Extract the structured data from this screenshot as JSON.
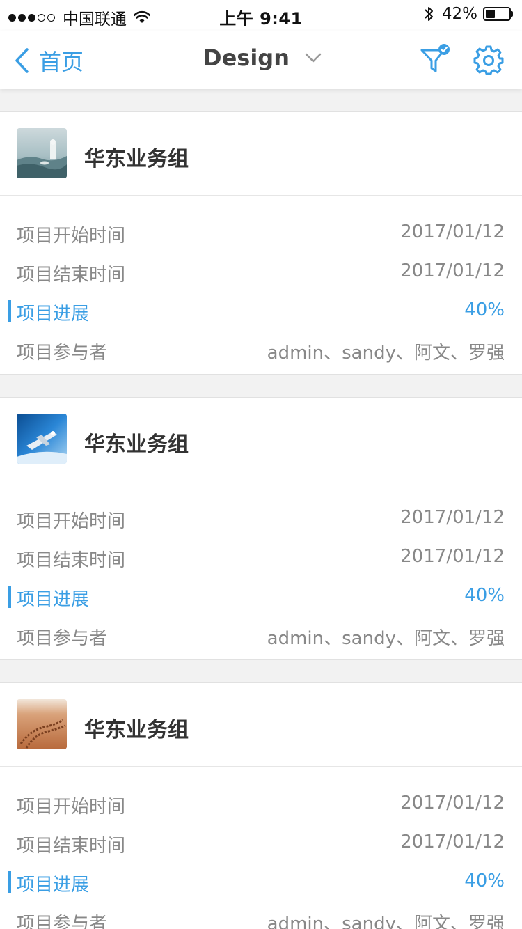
{
  "status_bar": {
    "carrier": "中国联通",
    "time": "上午 9:41",
    "battery_percent": "42%",
    "battery_level": 0.42,
    "signal_bars": 3
  },
  "nav": {
    "back_label": "首页",
    "title": "Design",
    "accent_color": "#3a9ee4"
  },
  "projects": [
    {
      "group_name": "华东业务组",
      "thumbnail": "snowy-landscape",
      "rows": [
        {
          "label": "项目开始时间",
          "value": "2017/01/12"
        },
        {
          "label": "项目结束时间",
          "value": "2017/01/12"
        },
        {
          "label": "项目进展",
          "value": "40%"
        },
        {
          "label": "项目参与者",
          "value": "admin、sandy、阿文、罗强"
        }
      ]
    },
    {
      "group_name": "华东业务组",
      "thumbnail": "spacecraft-in-orbit",
      "rows": [
        {
          "label": "项目开始时间",
          "value": "2017/01/12"
        },
        {
          "label": "项目结束时间",
          "value": "2017/01/12"
        },
        {
          "label": "项目进展",
          "value": "40%"
        },
        {
          "label": "项目参与者",
          "value": "admin、sandy、阿文、罗强"
        }
      ]
    },
    {
      "group_name": "华东业务组",
      "thumbnail": "desert-tracks",
      "rows": [
        {
          "label": "项目开始时间",
          "value": "2017/01/12"
        },
        {
          "label": "项目结束时间",
          "value": "2017/01/12"
        },
        {
          "label": "项目进展",
          "value": "40%"
        },
        {
          "label": "项目参与者",
          "value": "admin、sandy、阿文、罗强"
        }
      ]
    }
  ]
}
